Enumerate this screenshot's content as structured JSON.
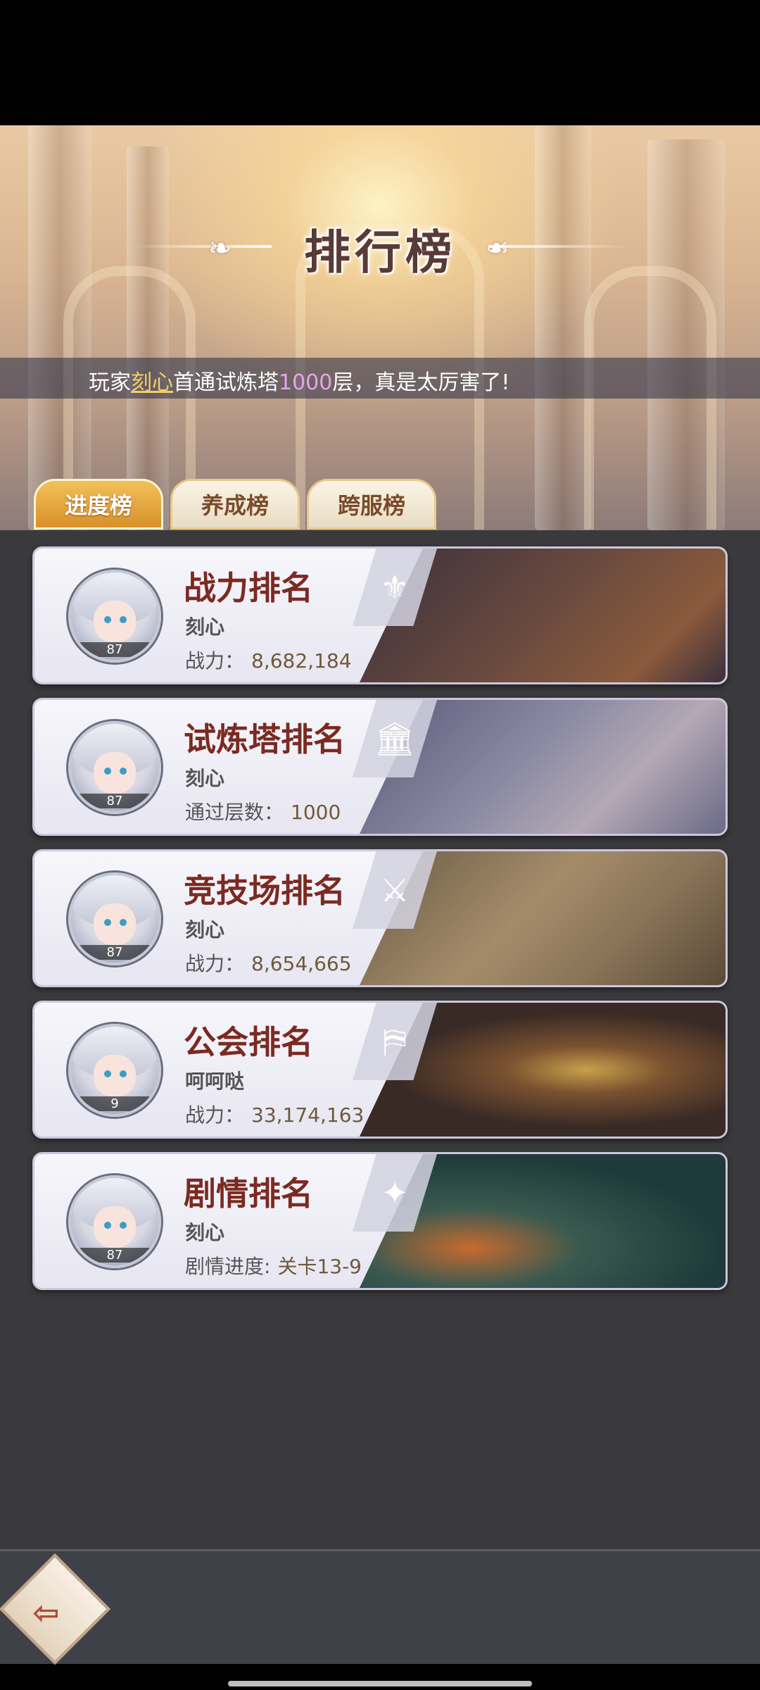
{
  "page": {
    "title": "排行榜",
    "notice": {
      "prefix": "玩家",
      "player": "刻心",
      "middle": "首通试炼塔",
      "number": "1000",
      "suffix": "层，真是太厉害了!"
    }
  },
  "tabs": [
    {
      "label": "进度榜",
      "active": true
    },
    {
      "label": "养成榜",
      "active": false
    },
    {
      "label": "跨服榜",
      "active": false
    }
  ],
  "cards": [
    {
      "title": "战力排名",
      "name": "刻心",
      "stat_label": "战力：",
      "stat_value": "8,682,184",
      "level": "87",
      "emblem_icon": "shield-icon"
    },
    {
      "title": "试炼塔排名",
      "name": "刻心",
      "stat_label": "通过层数：",
      "stat_value": "1000",
      "level": "87",
      "emblem_icon": "tower-icon"
    },
    {
      "title": "竞技场排名",
      "name": "刻心",
      "stat_label": "战力：",
      "stat_value": "8,654,665",
      "level": "87",
      "emblem_icon": "crossed-swords-icon"
    },
    {
      "title": "公会排名",
      "name": "呵呵哒",
      "stat_label": "战力：",
      "stat_value": "33,174,163",
      "level": "9",
      "emblem_icon": "banner-icon"
    },
    {
      "title": "剧情排名",
      "name": "刻心",
      "stat_label": "剧情进度:",
      "stat_value": "关卡13-9",
      "level": "87",
      "emblem_icon": "book-icon"
    }
  ],
  "colors": {
    "accent_gold": "#f2cf66",
    "accent_pink": "#e7a3ea",
    "card_title": "#7b2a22",
    "panel_bg": "#3a3a3c"
  }
}
